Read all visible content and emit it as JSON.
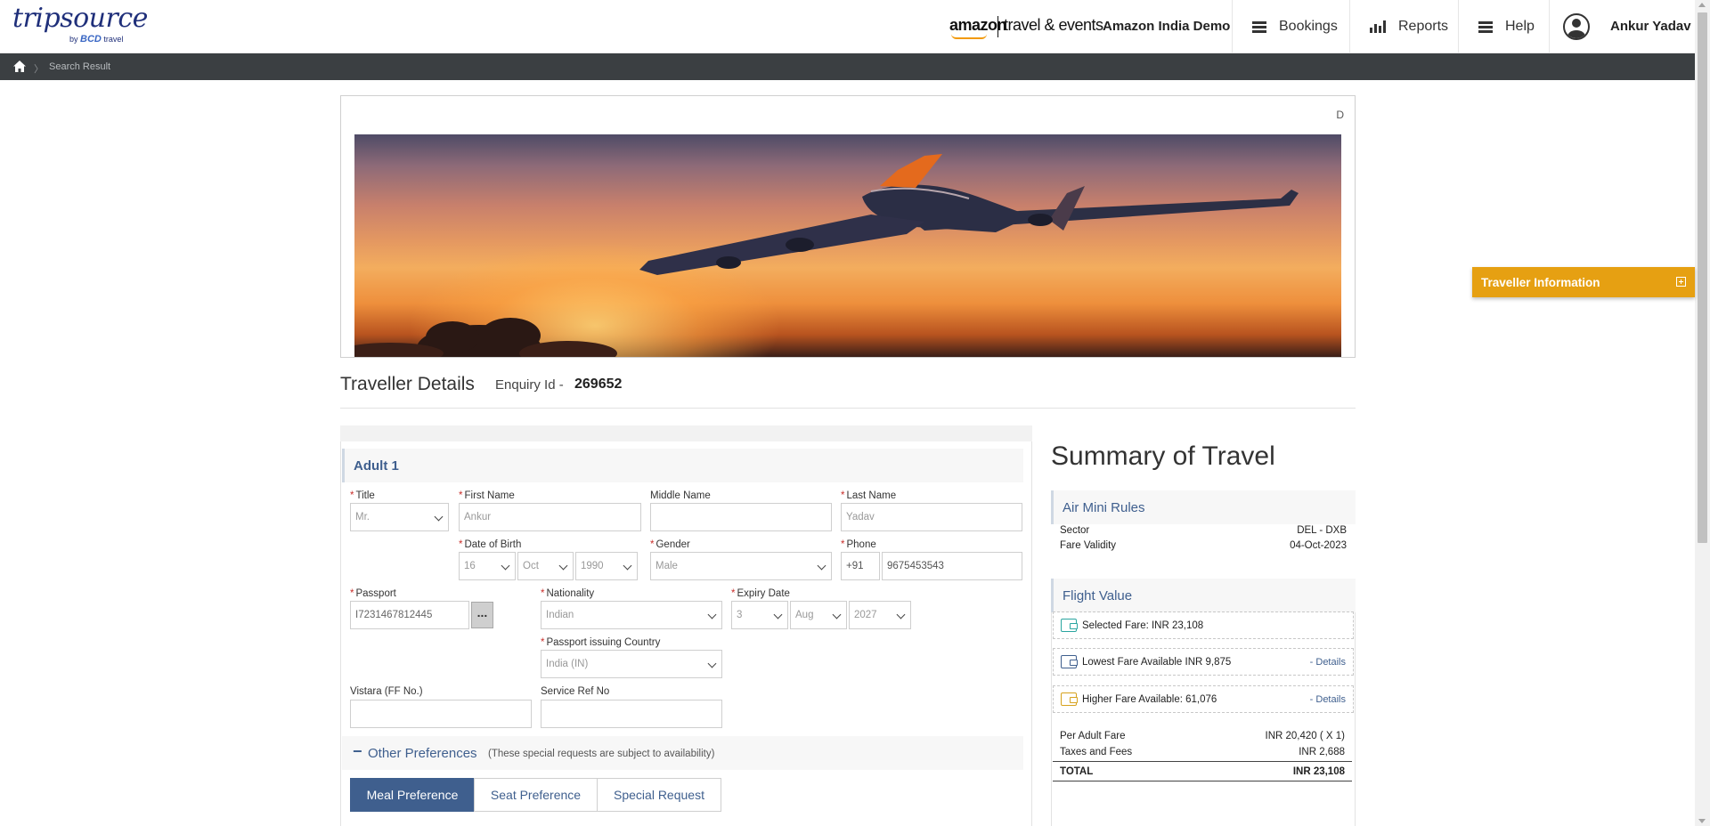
{
  "header": {
    "logo_main": "tripsource",
    "logo_by": "by",
    "logo_sub": "BCD",
    "logo_sub2": "travel",
    "brand_amazon": "amazon",
    "brand_travel_events": "travel & events",
    "company": "Amazon India Demo",
    "nav": [
      {
        "label": "Bookings",
        "icon": "menu-icon"
      },
      {
        "label": "Reports",
        "icon": "bar-chart-icon"
      },
      {
        "label": "Help",
        "icon": "menu-icon"
      }
    ],
    "user_name": "Ankur Yadav"
  },
  "breadcrumb": {
    "items": [
      "Search Result"
    ]
  },
  "banner": {
    "corner_text": "D"
  },
  "traveller": {
    "title": "Traveller Details",
    "enquiry_label": "Enquiry Id -",
    "enquiry_id": "269652",
    "adult_label": "Adult 1",
    "fields": {
      "title": {
        "label": "Title",
        "value": "Mr."
      },
      "first_name": {
        "label": "First Name",
        "value": "Ankur"
      },
      "middle_name": {
        "label": "Middle Name",
        "value": ""
      },
      "last_name": {
        "label": "Last Name",
        "value": "Yadav"
      },
      "dob": {
        "label": "Date of Birth",
        "day": "16",
        "month": "Oct",
        "year": "1990"
      },
      "gender": {
        "label": "Gender",
        "value": "Male"
      },
      "phone": {
        "label": "Phone",
        "code": "+91",
        "number": "9675453543"
      },
      "passport": {
        "label": "Passport",
        "value": "I7231467812445",
        "more": "..."
      },
      "nationality": {
        "label": "Nationality",
        "value": "Indian"
      },
      "expiry": {
        "label": "Expiry Date",
        "day": "3",
        "month": "Aug",
        "year": "2027"
      },
      "issuing_country": {
        "label": "Passport issuing Country",
        "value": "India (IN)"
      },
      "ff_no": {
        "label": "Vistara (FF No.)",
        "value": ""
      },
      "service_ref": {
        "label": "Service Ref No",
        "value": ""
      }
    },
    "other_preferences": {
      "toggle": "−",
      "title": "Other Preferences",
      "note": "(These special requests are subject to availability)"
    },
    "tabs": [
      "Meal Preference",
      "Seat Preference",
      "Special Request"
    ],
    "active_tab": "Meal Preference"
  },
  "summary": {
    "title": "Summary of Travel",
    "air_mini_rules": {
      "title": "Air Mini Rules",
      "rows": [
        {
          "label": "Sector",
          "value": "DEL - DXB"
        },
        {
          "label": "Fare Validity",
          "value": "04-Oct-2023"
        }
      ]
    },
    "flight_value": {
      "title": "Flight Value",
      "fares": [
        {
          "text": "Selected Fare: INR 23,108",
          "details": "",
          "icon": "wallet-icon",
          "color": "#2aa5a0"
        },
        {
          "text": "Lowest Fare Available INR 9,875",
          "details": "- Details",
          "icon": "wallet-icon",
          "color": "#3f5f8e"
        },
        {
          "text": "Higher Fare Available: 61,076",
          "details": "- Details",
          "icon": "wallet-icon",
          "color": "#d6a21e"
        }
      ],
      "per_adult_label": "Per Adult Fare",
      "per_adult_value": "INR 20,420 ( X 1)",
      "taxes_label": "Taxes and Fees",
      "taxes_value": "INR 2,688",
      "total_label": "TOTAL",
      "total_value": "INR 23,108"
    }
  },
  "traveller_info_tab": {
    "label": "Traveller Information",
    "color": "#e6a012"
  },
  "colors": {
    "accent": "#3f5f8e",
    "breadcrumb_bg": "#3b3f42",
    "required": "#c9302c"
  }
}
